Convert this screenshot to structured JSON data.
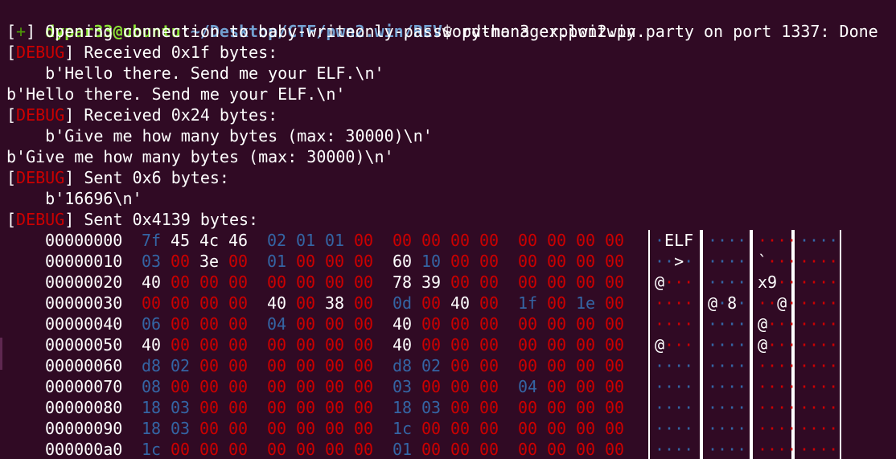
{
  "terminal": {
    "prompt_user": "dypar33@ubuntu",
    "prompt_colon": ":",
    "prompt_path": "~/Desktop/CTF/pwn2.win/REV",
    "prompt_sign": "$ ",
    "command": "python3 exploit.py",
    "lines": [
      {
        "open": "[",
        "tag": "+",
        "close": "] ",
        "text": "Opening connection to baby-writeonly-password-manager.pwn2win.party on port 1337: Done",
        "tag_kind": "plus"
      },
      {
        "open": "[",
        "tag": "DEBUG",
        "close": "] ",
        "text": "Received 0x1f bytes:",
        "tag_kind": "debug"
      },
      {
        "text": "    b'Hello there. Send me your ELF.\\n'"
      },
      {
        "text": "b'Hello there. Send me your ELF.\\n'"
      },
      {
        "open": "[",
        "tag": "DEBUG",
        "close": "] ",
        "text": "Received 0x24 bytes:",
        "tag_kind": "debug"
      },
      {
        "text": "    b'Give me how many bytes (max: 30000)\\n'"
      },
      {
        "text": "b'Give me how many bytes (max: 30000)\\n'"
      },
      {
        "open": "[",
        "tag": "DEBUG",
        "close": "] ",
        "text": "Sent 0x6 bytes:",
        "tag_kind": "debug"
      },
      {
        "text": "    b'16696\\n'"
      },
      {
        "open": "[",
        "tag": "DEBUG",
        "close": "] ",
        "text": "Sent 0x4139 bytes:",
        "tag_kind": "debug"
      }
    ],
    "hexdump": [
      {
        "offset": "00000000",
        "bytes": [
          "7f",
          "45",
          "4c",
          "46",
          "02",
          "01",
          "01",
          "00",
          "00",
          "00",
          "00",
          "00",
          "00",
          "00",
          "00",
          "00"
        ],
        "colors": [
          "b",
          "w",
          "w",
          "w",
          "b",
          "b",
          "b",
          "r",
          "r",
          "r",
          "r",
          "r",
          "r",
          "r",
          "r",
          "r"
        ]
      },
      {
        "offset": "00000010",
        "bytes": [
          "03",
          "00",
          "3e",
          "00",
          "01",
          "00",
          "00",
          "00",
          "60",
          "10",
          "00",
          "00",
          "00",
          "00",
          "00",
          "00"
        ],
        "colors": [
          "b",
          "r",
          "w",
          "r",
          "b",
          "r",
          "r",
          "r",
          "w",
          "b",
          "r",
          "r",
          "r",
          "r",
          "r",
          "r"
        ]
      },
      {
        "offset": "00000020",
        "bytes": [
          "40",
          "00",
          "00",
          "00",
          "00",
          "00",
          "00",
          "00",
          "78",
          "39",
          "00",
          "00",
          "00",
          "00",
          "00",
          "00"
        ],
        "colors": [
          "w",
          "r",
          "r",
          "r",
          "r",
          "r",
          "r",
          "r",
          "w",
          "w",
          "r",
          "r",
          "r",
          "r",
          "r",
          "r"
        ]
      },
      {
        "offset": "00000030",
        "bytes": [
          "00",
          "00",
          "00",
          "00",
          "40",
          "00",
          "38",
          "00",
          "0d",
          "00",
          "40",
          "00",
          "1f",
          "00",
          "1e",
          "00"
        ],
        "colors": [
          "r",
          "r",
          "r",
          "r",
          "w",
          "r",
          "w",
          "r",
          "b",
          "r",
          "w",
          "r",
          "b",
          "r",
          "b",
          "r"
        ]
      },
      {
        "offset": "00000040",
        "bytes": [
          "06",
          "00",
          "00",
          "00",
          "04",
          "00",
          "00",
          "00",
          "40",
          "00",
          "00",
          "00",
          "00",
          "00",
          "00",
          "00"
        ],
        "colors": [
          "b",
          "r",
          "r",
          "r",
          "b",
          "r",
          "r",
          "r",
          "w",
          "r",
          "r",
          "r",
          "r",
          "r",
          "r",
          "r"
        ]
      },
      {
        "offset": "00000050",
        "bytes": [
          "40",
          "00",
          "00",
          "00",
          "00",
          "00",
          "00",
          "00",
          "40",
          "00",
          "00",
          "00",
          "00",
          "00",
          "00",
          "00"
        ],
        "colors": [
          "w",
          "r",
          "r",
          "r",
          "r",
          "r",
          "r",
          "r",
          "w",
          "r",
          "r",
          "r",
          "r",
          "r",
          "r",
          "r"
        ]
      },
      {
        "offset": "00000060",
        "bytes": [
          "d8",
          "02",
          "00",
          "00",
          "00",
          "00",
          "00",
          "00",
          "d8",
          "02",
          "00",
          "00",
          "00",
          "00",
          "00",
          "00"
        ],
        "colors": [
          "b",
          "b",
          "r",
          "r",
          "r",
          "r",
          "r",
          "r",
          "b",
          "b",
          "r",
          "r",
          "r",
          "r",
          "r",
          "r"
        ]
      },
      {
        "offset": "00000070",
        "bytes": [
          "08",
          "00",
          "00",
          "00",
          "00",
          "00",
          "00",
          "00",
          "03",
          "00",
          "00",
          "00",
          "04",
          "00",
          "00",
          "00"
        ],
        "colors": [
          "b",
          "r",
          "r",
          "r",
          "r",
          "r",
          "r",
          "r",
          "b",
          "r",
          "r",
          "r",
          "b",
          "r",
          "r",
          "r"
        ]
      },
      {
        "offset": "00000080",
        "bytes": [
          "18",
          "03",
          "00",
          "00",
          "00",
          "00",
          "00",
          "00",
          "18",
          "03",
          "00",
          "00",
          "00",
          "00",
          "00",
          "00"
        ],
        "colors": [
          "b",
          "b",
          "r",
          "r",
          "r",
          "r",
          "r",
          "r",
          "b",
          "b",
          "r",
          "r",
          "r",
          "r",
          "r",
          "r"
        ]
      },
      {
        "offset": "00000090",
        "bytes": [
          "18",
          "03",
          "00",
          "00",
          "00",
          "00",
          "00",
          "00",
          "1c",
          "00",
          "00",
          "00",
          "00",
          "00",
          "00",
          "00"
        ],
        "colors": [
          "b",
          "b",
          "r",
          "r",
          "r",
          "r",
          "r",
          "r",
          "b",
          "r",
          "r",
          "r",
          "r",
          "r",
          "r",
          "r"
        ]
      },
      {
        "offset": "000000a0",
        "bytes": [
          "1c",
          "00",
          "00",
          "00",
          "00",
          "00",
          "00",
          "00",
          "01",
          "00",
          "00",
          "00",
          "00",
          "00",
          "00",
          "00"
        ],
        "colors": [
          "b",
          "r",
          "r",
          "r",
          "r",
          "r",
          "r",
          "r",
          "b",
          "r",
          "r",
          "r",
          "r",
          "r",
          "r",
          "r"
        ]
      }
    ],
    "ascii": [
      [
        "·ELF",
        "····",
        "····",
        "····"
      ],
      [
        "··>·",
        "····",
        "`···",
        "····"
      ],
      [
        "@···",
        "····",
        "x9··",
        "····"
      ],
      [
        "····",
        "@·8·",
        "··@·",
        "····"
      ],
      [
        "····",
        "····",
        "@···",
        "····"
      ],
      [
        "@···",
        "····",
        "@···",
        "····"
      ],
      [
        "····",
        "····",
        "····",
        "····"
      ],
      [
        "····",
        "····",
        "····",
        "····"
      ],
      [
        "····",
        "····",
        "····",
        "····"
      ],
      [
        "····",
        "····",
        "····",
        "····"
      ],
      [
        "····",
        "····",
        "····",
        "····"
      ]
    ],
    "colors": {
      "background": "#300a24",
      "user": "#8ae234",
      "path": "#729fcf",
      "debug": "#cc0000",
      "plus": "#4e9a06",
      "hex_white": "#ffffff",
      "hex_red": "#cc0000",
      "hex_blue": "#3465a4"
    }
  }
}
